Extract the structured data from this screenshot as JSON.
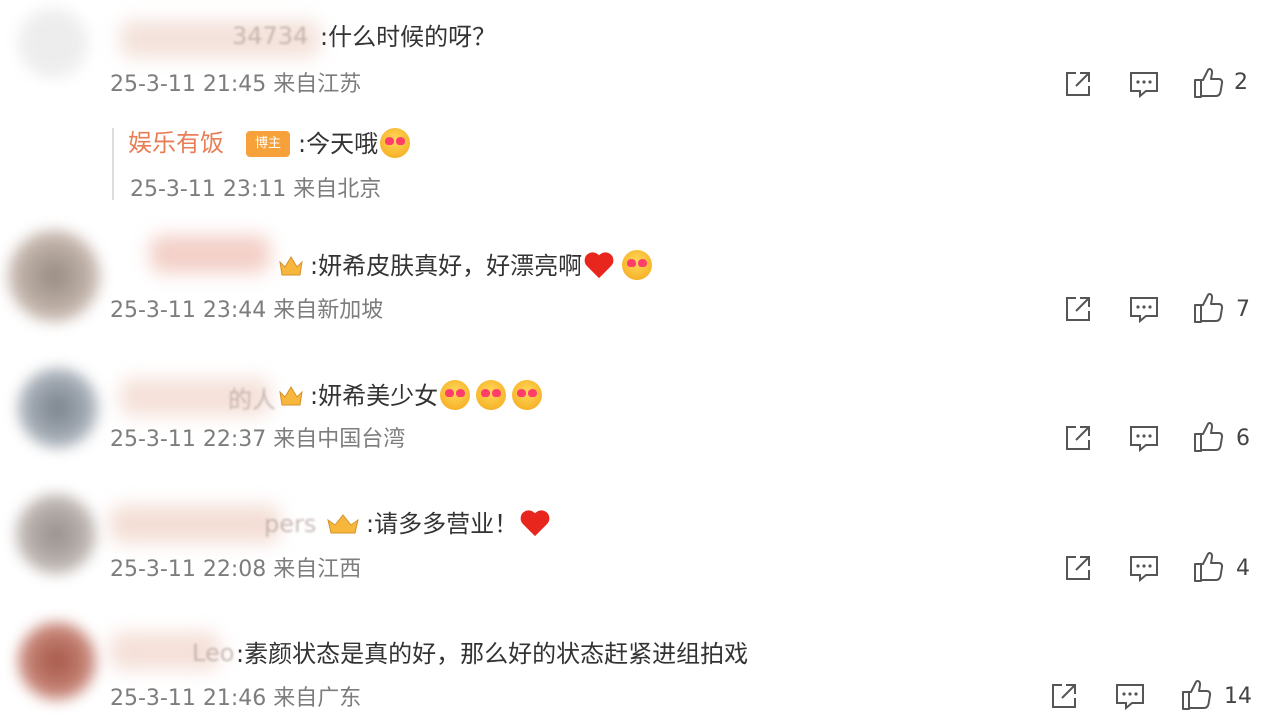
{
  "comments": [
    {
      "name_fragment": "34734",
      "text": ":什么时候的呀？",
      "time": "25-3-11 21:45",
      "location": "来自江苏",
      "likes": "2"
    },
    {
      "name_fragment": "",
      "text": ":妍希皮肤真好，好漂亮啊",
      "time": "25-3-11 23:44",
      "location": "来自新加坡",
      "likes": "7"
    },
    {
      "name_fragment": "的人",
      "text": ":妍希美少女",
      "time": "25-3-11 22:37",
      "location": "来自中国台湾",
      "likes": "6"
    },
    {
      "name_fragment": "pers",
      "text": ":请多多营业！",
      "time": "25-3-11 22:08",
      "location": "来自江西",
      "likes": "4"
    },
    {
      "name_fragment": "Leo",
      "text": ":素颜状态是真的好，那么好的状态赶紧进组拍戏",
      "time": "25-3-11 21:46",
      "location": "来自广东",
      "likes": "14"
    }
  ],
  "reply": {
    "author": "娱乐有饭",
    "badge": "博主",
    "text": ":今天哦",
    "time": "25-3-11 23:11",
    "location": "来自北京"
  },
  "colors": {
    "text": "#333333",
    "meta": "#7d7d7d",
    "reply_author": "#e87e55",
    "badge": "#f7a13a",
    "heart": "#e8261d"
  },
  "icons": {
    "share": "share-icon",
    "comment": "comment-icon",
    "like": "thumbs-up-icon"
  }
}
